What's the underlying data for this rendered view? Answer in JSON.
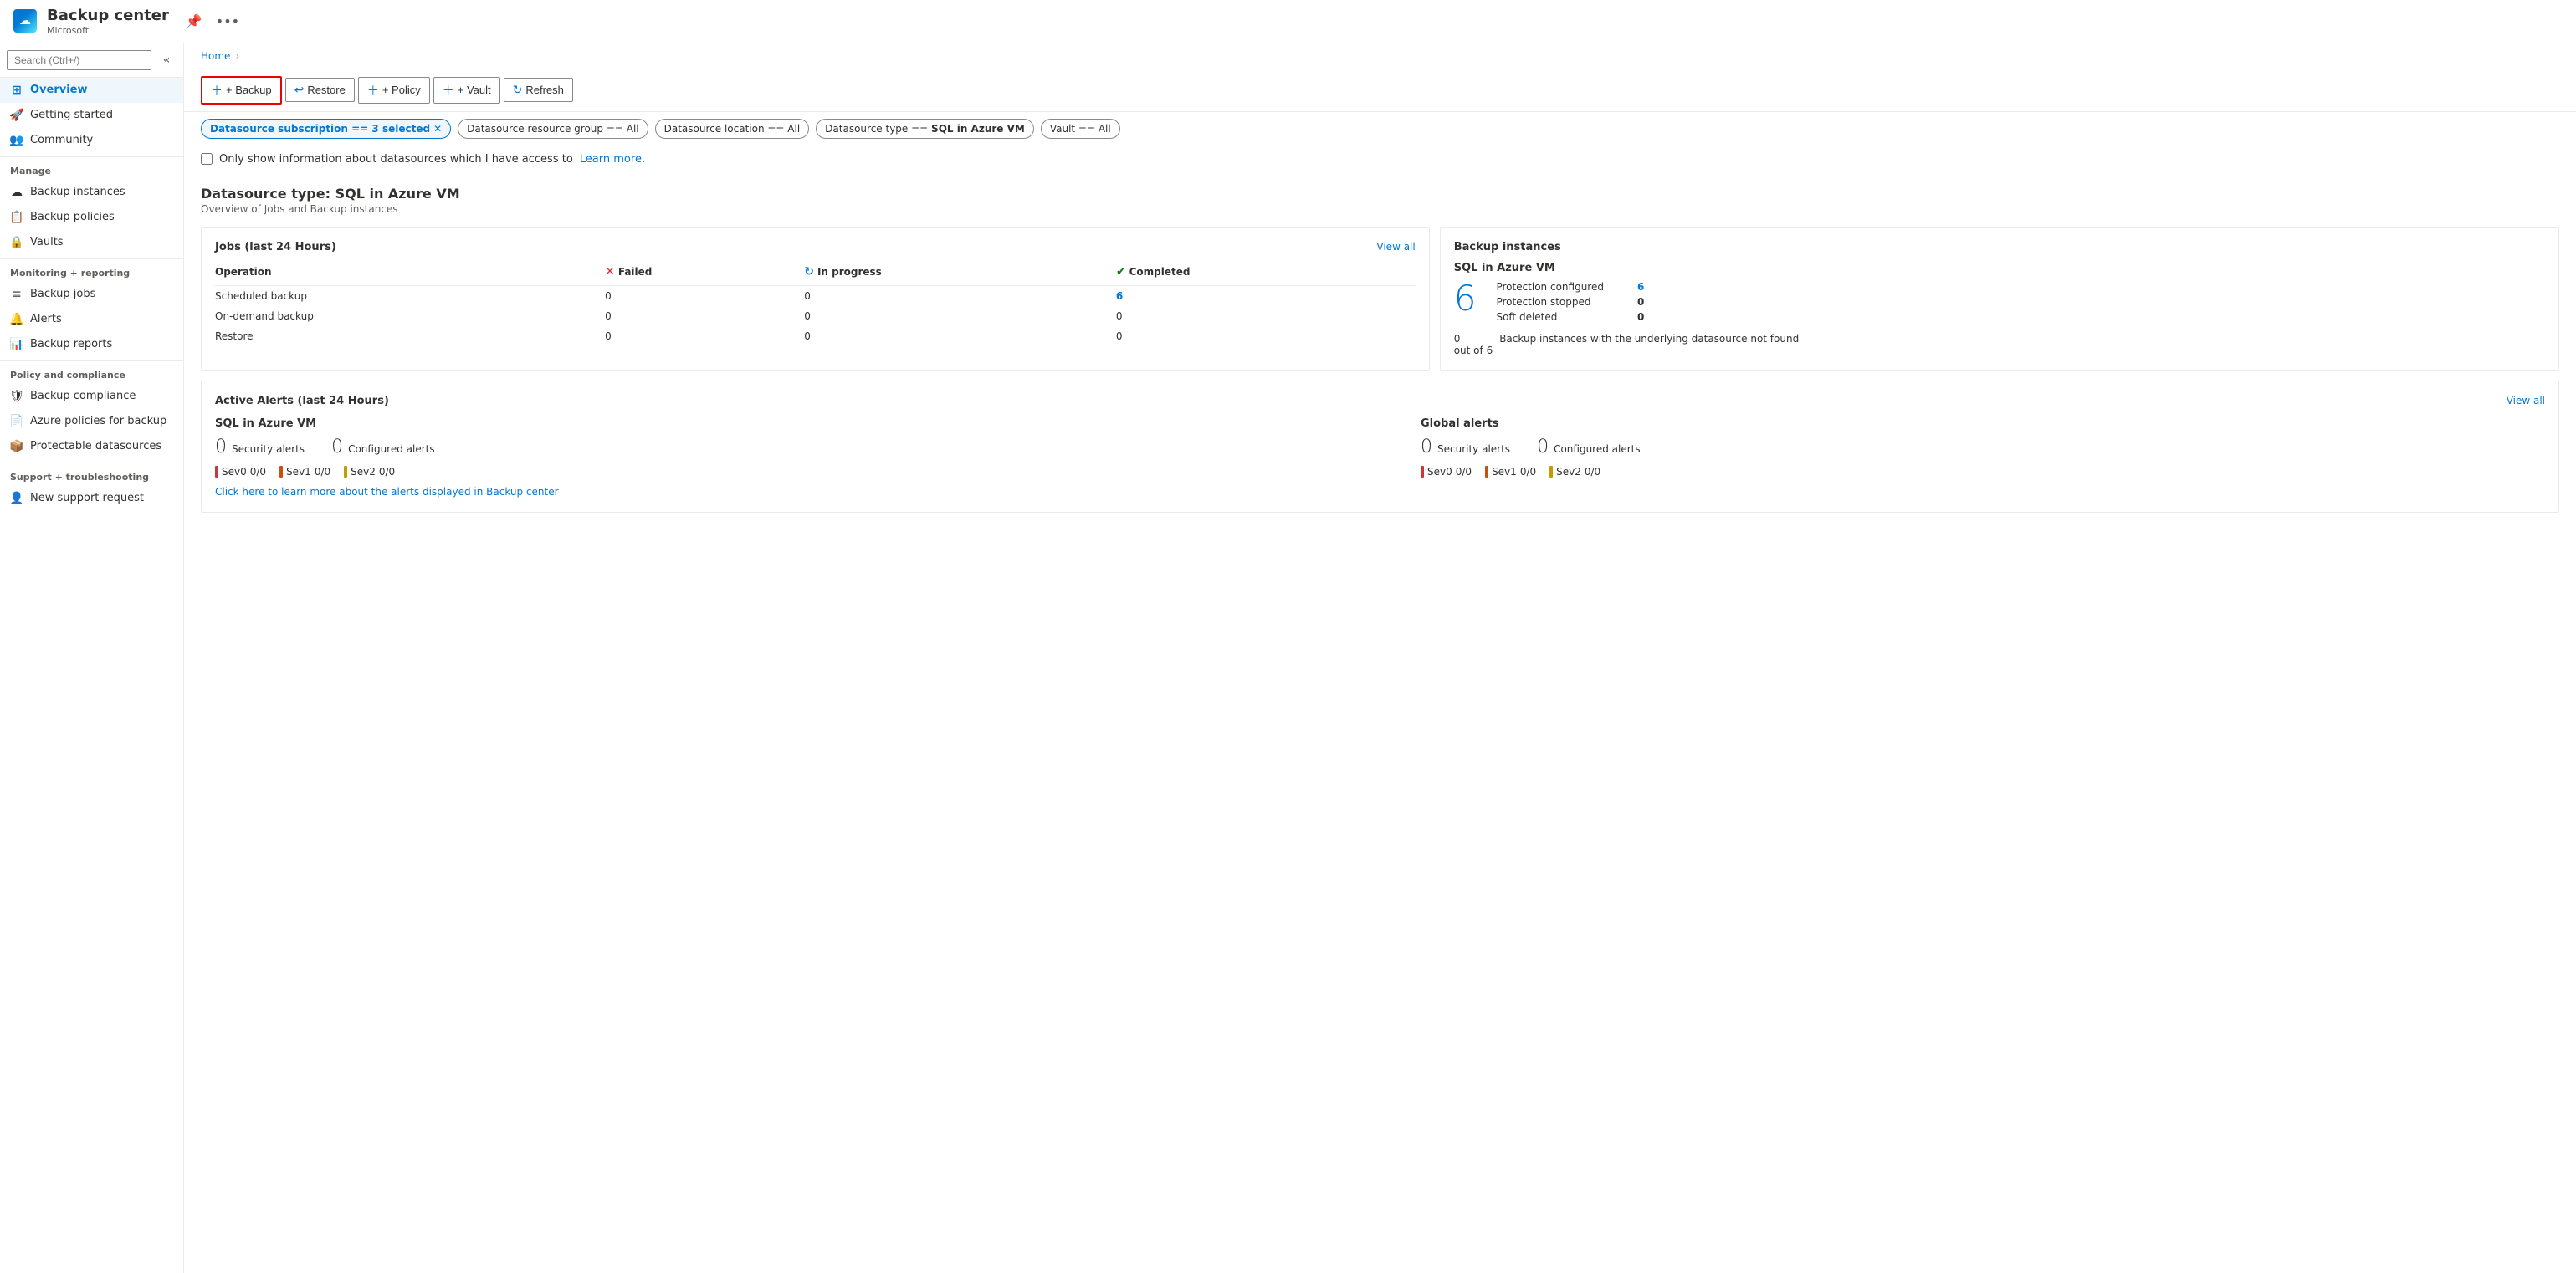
{
  "app": {
    "title": "Backup center",
    "subtitle": "Microsoft",
    "breadcrumb": [
      "Home"
    ]
  },
  "toolbar": {
    "backup_label": "+ Backup",
    "restore_label": "Restore",
    "policy_label": "+ Policy",
    "vault_label": "+ Vault",
    "refresh_label": "Refresh"
  },
  "filters": [
    {
      "label": "Datasource subscription == 3 selected",
      "active": true
    },
    {
      "label": "Datasource resource group == All",
      "active": false
    },
    {
      "label": "Datasource location == All",
      "active": false
    },
    {
      "label": "Datasource type == SQL in Azure VM",
      "active": false
    },
    {
      "label": "Vault == All",
      "active": false
    }
  ],
  "checkbox": {
    "label": "Only show information about datasources which I have access to",
    "learn_more_text": "Learn more."
  },
  "main": {
    "datasource_type_label": "Datasource type: SQL in Azure VM",
    "datasource_subtitle": "Overview of Jobs and Backup instances"
  },
  "jobs_card": {
    "title": "Jobs (last 24 Hours)",
    "view_all": "View all",
    "columns": [
      "Operation",
      "Failed",
      "In progress",
      "Completed"
    ],
    "rows": [
      {
        "operation": "Scheduled backup",
        "failed": "0",
        "in_progress": "0",
        "completed": "6"
      },
      {
        "operation": "On-demand backup",
        "failed": "0",
        "in_progress": "0",
        "completed": "0"
      },
      {
        "operation": "Restore",
        "failed": "0",
        "in_progress": "0",
        "completed": "0"
      }
    ]
  },
  "backup_instances_card": {
    "title": "Backup instances",
    "section_label": "SQL in Azure VM",
    "big_number": "6",
    "stats": [
      {
        "label": "Protection configured",
        "value": "6",
        "link": true
      },
      {
        "label": "Protection stopped",
        "value": "0",
        "link": false
      },
      {
        "label": "Soft deleted",
        "value": "0",
        "link": false
      }
    ],
    "footer_num": "0",
    "footer_out_of": "out of 6",
    "footer_text": "Backup instances with the underlying datasource not found"
  },
  "alerts_card": {
    "title": "Active Alerts (last 24 Hours)",
    "view_all": "View all",
    "sections": [
      {
        "title": "SQL in Azure VM",
        "security_alerts_num": "0",
        "security_alerts_label": "Security alerts",
        "configured_alerts_num": "0",
        "configured_alerts_label": "Configured alerts",
        "sev_items": [
          {
            "label": "Sev0",
            "value": "0/0",
            "color": "red"
          },
          {
            "label": "Sev1",
            "value": "0/0",
            "color": "orange"
          },
          {
            "label": "Sev2",
            "value": "0/0",
            "color": "yellow"
          }
        ]
      },
      {
        "title": "Global alerts",
        "security_alerts_num": "0",
        "security_alerts_label": "Security alerts",
        "configured_alerts_num": "0",
        "configured_alerts_label": "Configured alerts",
        "sev_items": [
          {
            "label": "Sev0",
            "value": "0/0",
            "color": "red"
          },
          {
            "label": "Sev1",
            "value": "0/0",
            "color": "orange"
          },
          {
            "label": "Sev2",
            "value": "0/0",
            "color": "yellow"
          }
        ]
      }
    ],
    "footer_link": "Click here to learn more about the alerts displayed in Backup center"
  },
  "sidebar": {
    "search_placeholder": "Search (Ctrl+/)",
    "items_top": [
      {
        "label": "Overview",
        "icon": "⊞",
        "active": true
      },
      {
        "label": "Getting started",
        "icon": "🚀",
        "active": false
      },
      {
        "label": "Community",
        "icon": "👥",
        "active": false
      }
    ],
    "manage_label": "Manage",
    "items_manage": [
      {
        "label": "Backup instances",
        "icon": "☁",
        "active": false
      },
      {
        "label": "Backup policies",
        "icon": "📋",
        "active": false
      },
      {
        "label": "Vaults",
        "icon": "🔒",
        "active": false
      }
    ],
    "monitoring_label": "Monitoring + reporting",
    "items_monitoring": [
      {
        "label": "Backup jobs",
        "icon": "≡",
        "active": false
      },
      {
        "label": "Alerts",
        "icon": "🔔",
        "active": false
      },
      {
        "label": "Backup reports",
        "icon": "📊",
        "active": false
      }
    ],
    "policy_label": "Policy and compliance",
    "items_policy": [
      {
        "label": "Backup compliance",
        "icon": "🛡",
        "active": false
      },
      {
        "label": "Azure policies for backup",
        "icon": "📄",
        "active": false
      },
      {
        "label": "Protectable datasources",
        "icon": "📦",
        "active": false
      }
    ],
    "support_label": "Support + troubleshooting",
    "items_support": [
      {
        "label": "New support request",
        "icon": "👤",
        "active": false
      }
    ]
  }
}
